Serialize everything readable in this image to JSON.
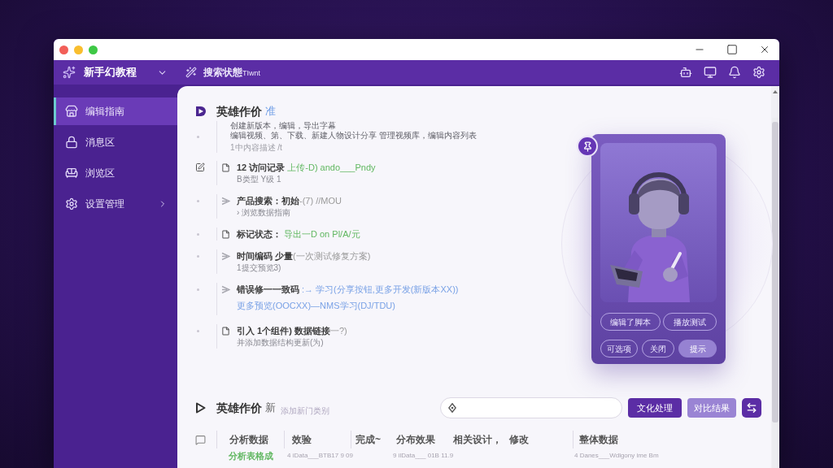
{
  "header": {
    "app_name": "新手幻教程",
    "breadcrumb": "搜索状態",
    "breadcrumb_suffix": "TIwnt"
  },
  "sidebar": {
    "items": [
      {
        "label": "编辑指南",
        "selected": true,
        "kind": "link"
      },
      {
        "label": "消息区",
        "selected": false,
        "kind": "link"
      },
      {
        "label": "浏览区",
        "selected": false,
        "kind": "link"
      },
      {
        "label": "设置管理",
        "selected": false,
        "kind": "group"
      }
    ]
  },
  "intro": {
    "title": "英雄作价",
    "tag": "准",
    "lines": [
      "创建新版本，编辑，导出字幕",
      "编辑视频、第、下载、新建人物设计分享 管理视频库，编辑内容列表",
      "1中内容描述 /t"
    ]
  },
  "entries": [
    {
      "kind": "doc",
      "current": true,
      "title": "12 访问记录",
      "highlight": "上传-D) ando___Pndy",
      "color": "#62b862",
      "note": {
        "text": "B类型 Y级 1"
      }
    },
    {
      "kind": "step",
      "current": false,
      "title": "产品搜索：初始",
      "suffix": "-(7) //MOU",
      "note": {
        "text": "› 浏览数据指南"
      }
    },
    {
      "kind": "doc",
      "current": false,
      "title": "标记状态：",
      "highlight": "导出一D on Pl/A/元",
      "color": "#62b862"
    },
    {
      "kind": "step",
      "current": false,
      "title": "时间编码 少量",
      "suffix": "(一次测试修复方案)",
      "note": {
        "text": "1提交预览3)"
      }
    },
    {
      "kind": "step",
      "current": false,
      "title": "错误修一一致码",
      "highlight": ":→ 学习(分享按钮,更多开发(新版本XX))",
      "color": "#7aa2e6",
      "note": {
        "text": "更多预览(OOCXX)—NMS学习(DJ/TDU)",
        "color": "#7aa2e6"
      }
    },
    {
      "kind": "doc",
      "current": false,
      "title": "引入 1个组件) 数据链接",
      "suffix": "一?)",
      "note": {
        "text": "并添加数据结构更新(为)"
      }
    }
  ],
  "card": {
    "chips": [
      {
        "label": "编辑了脚本",
        "selected": false
      },
      {
        "label": "播放测试",
        "selected": false
      },
      {
        "label": "可选项",
        "selected": false
      },
      {
        "label": "关闭",
        "selected": false
      },
      {
        "label": "提示",
        "selected": true
      }
    ]
  },
  "section": {
    "title": "英雄作价",
    "tag": "新",
    "subtitle": "添加新门类别",
    "buttons": [
      {
        "label": "文化处理",
        "kind": "primary"
      },
      {
        "label": "对比结果",
        "kind": "secondary"
      }
    ]
  },
  "table": {
    "columns": [
      "分析数据",
      "效验",
      "完成~",
      "分布效果",
      "相关设计，",
      "修改",
      "整体数据"
    ],
    "rows": [
      {
        "cells": [
          {
            "text": "分析表格成",
            "color": "#62b862"
          },
          {
            "text": "4 iData___BTB17 9 09"
          },
          {
            "text": ""
          },
          {
            "text": "9 ilData___ 01B 11.9"
          },
          {
            "text": ""
          },
          {
            "text": ""
          },
          {
            "text": "4 Danes___Wdlgony ime Bm"
          }
        ]
      }
    ]
  }
}
